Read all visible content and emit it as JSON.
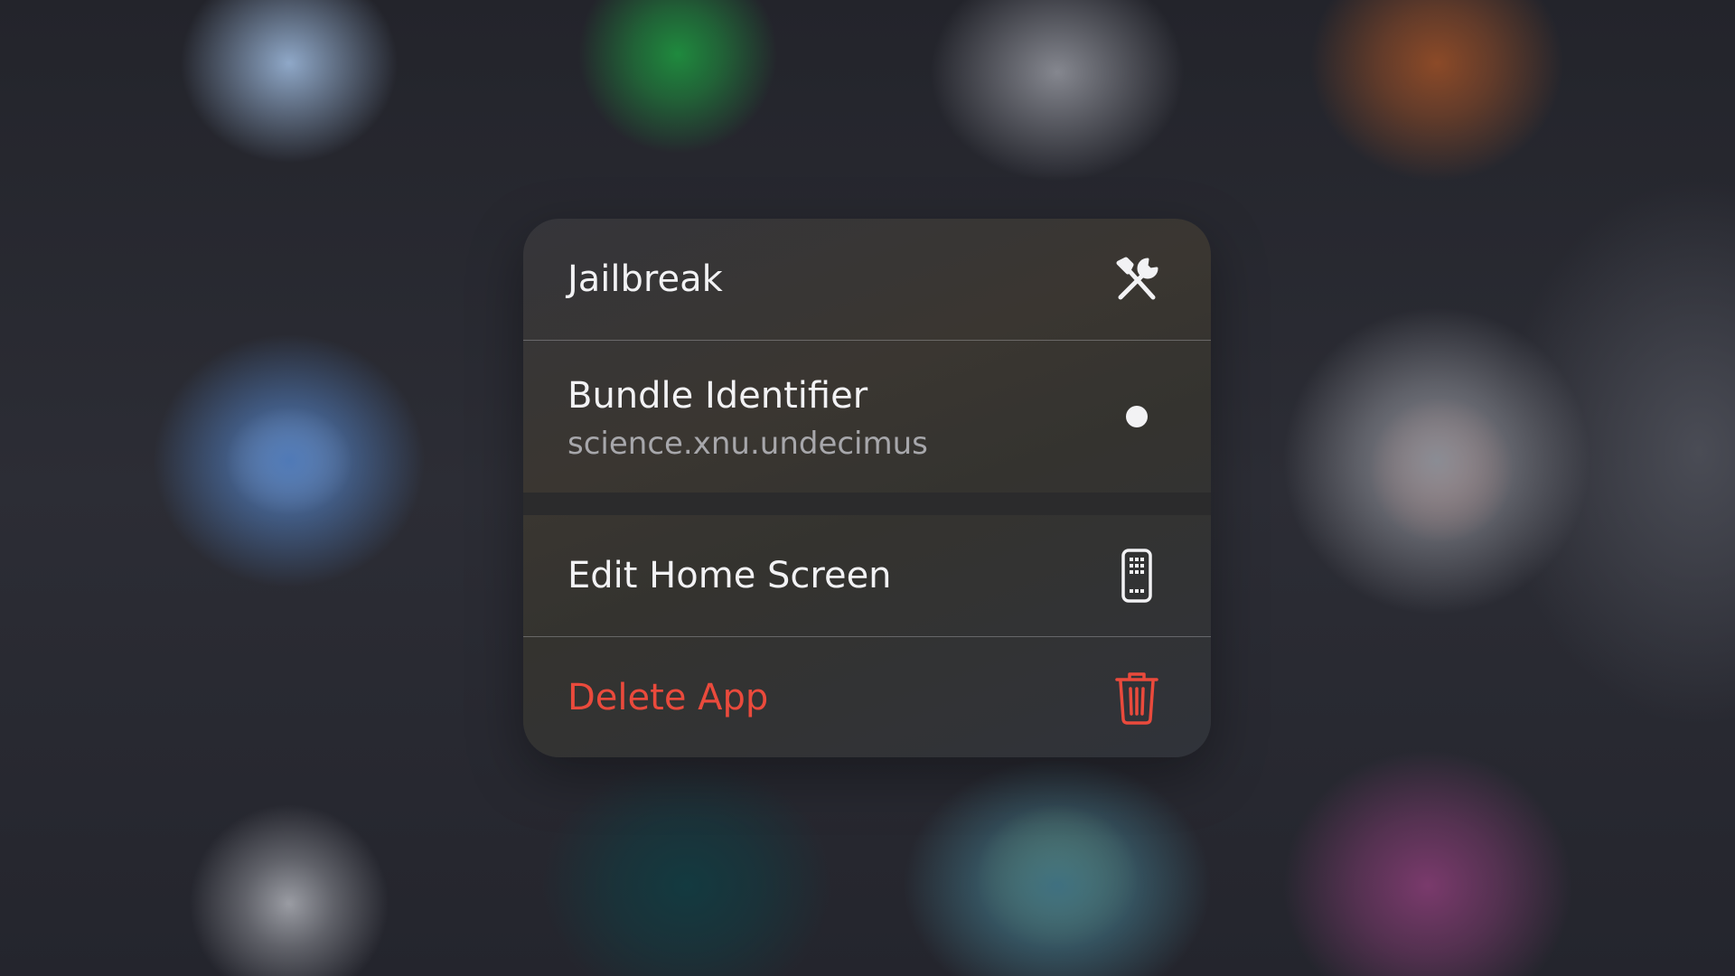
{
  "menu": {
    "items": [
      {
        "label": "Jailbreak",
        "icon": "wrench-screwdriver-icon"
      },
      {
        "label": "Bundle Identifier",
        "sublabel": "science.xnu.undecimus",
        "icon": "dot-icon"
      },
      {
        "label": "Edit Home Screen",
        "icon": "phone-apps-icon"
      },
      {
        "label": "Delete App",
        "icon": "trash-icon",
        "color": "#ea4a3c"
      }
    ]
  },
  "colors": {
    "destructive": "#ea4a3c",
    "primary_text": "#f2f2f4",
    "secondary_text": "#a7a7ab"
  }
}
